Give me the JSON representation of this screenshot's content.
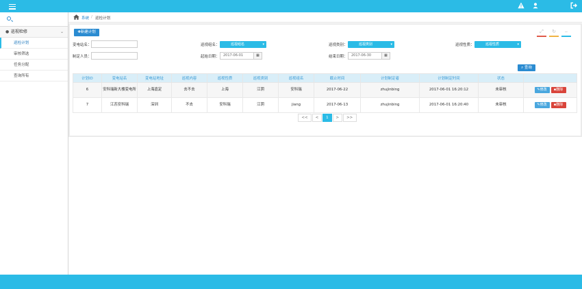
{
  "topbar": {
    "menu_icon": "hamburger-icon",
    "alert_icon": "warning-icon",
    "user_icon": "user-icon",
    "logout_icon": "logout-icon",
    "color": "#2bbbe6"
  },
  "breadcrumb": {
    "home_icon": "home-icon",
    "items": [
      "系统",
      "巡检计划"
    ],
    "separator": "/"
  },
  "sidebar": {
    "group_label": "巡视检修",
    "items": [
      {
        "label": "巡检计划",
        "active": true
      },
      {
        "label": "审核筛选",
        "active": false
      },
      {
        "label": "任务分配",
        "active": false
      },
      {
        "label": "查询所有",
        "active": false
      }
    ]
  },
  "toolbar": {
    "add_label": "✚新建计划",
    "search_label": "查询"
  },
  "filters": {
    "station_label": "变电站名：",
    "station_value": "",
    "patrol_group_label": "巡视组名：",
    "patrol_group_value": "巡视组名",
    "patrol_category_label": "巡视类别：",
    "patrol_category_value": "巡视类别",
    "patrol_nature_label": "巡视性质：",
    "patrol_nature_value": "巡视性质",
    "creator_label": "制定人员：",
    "creator_value": "",
    "start_date_label": "起始日期：",
    "start_date_value": "2017-06-01",
    "end_date_label": "结束日期：",
    "end_date_value": "2017-06-30"
  },
  "table": {
    "columns": [
      "计划ID",
      "变电站名",
      "变电站地址",
      "巡视内容",
      "巡视性质",
      "巡视类别",
      "巡视组名",
      "截止时间",
      "计划制定者",
      "计划制定时间",
      "状态",
      ""
    ],
    "rows": [
      {
        "id": "6",
        "station": "安科瑞新大楼变电所",
        "address": "上海嘉定",
        "content": "去不去",
        "nature": "上海",
        "category": "江阴",
        "group": "安科瑞",
        "deadline": "2017-06-22",
        "creator": "zhujinbing",
        "created": "2017-06-01 16:20:12",
        "status": "未审核",
        "edit": "修改",
        "delete": "删除"
      },
      {
        "id": "7",
        "station": "江苏安科瑞",
        "address": "深圳",
        "content": "不去",
        "nature": "安科瑞",
        "category": "江阴",
        "group": "jiang",
        "deadline": "2017-06-13",
        "creator": "zhujinbing",
        "created": "2017-06-01 16:20:40",
        "status": "未审核",
        "edit": "修改",
        "delete": "删除"
      }
    ]
  },
  "pager": {
    "first": "<<",
    "prev": "<",
    "current": "1",
    "next": ">",
    "last": ">>"
  },
  "colors": {
    "accent": "#2bbbe6",
    "button_blue": "#2a8bd1",
    "delete_red": "#d9443a",
    "header_bg": "#d9eef8"
  }
}
